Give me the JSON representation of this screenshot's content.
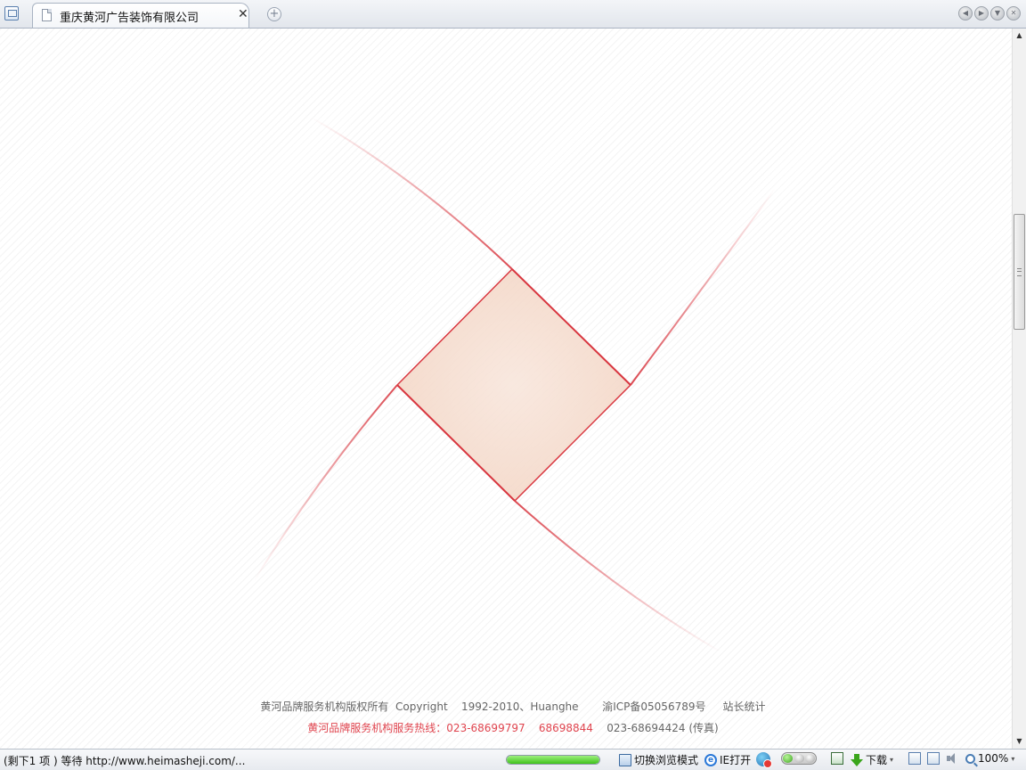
{
  "tab": {
    "title": "重庆黄河广告装饰有限公司",
    "close_glyph": "✕",
    "new_tab_glyph": "+"
  },
  "window_buttons": [
    "back-icon",
    "forward-icon",
    "menu-icon",
    "close-icon"
  ],
  "window_button_glyphs": [
    "◀",
    "▶",
    "▼",
    "✕"
  ],
  "colors": {
    "logo_red": "#d8363f",
    "logo_fill": "#f7dccd",
    "hotline_red": "#e0454f",
    "progress_green": "#3fc21a"
  },
  "footer": {
    "line1": "黄河品牌服务机构版权所有  Copyright    1992-2010、Huanghe       渝ICP备05056789号     站长统计",
    "hotline": "黄河品牌服务机构服务热线：023-68699797    68698844",
    "fax": "    023-68694424 (传真)"
  },
  "scrollbar": {
    "up_glyph": "▲",
    "down_glyph": "▼"
  },
  "status": {
    "text": "(剩下1 项 ) 等待 http://www.heimasheji.com/...",
    "progress_fraction": 1.0,
    "switch_mode_label": "切换浏览模式",
    "ie_open_label": "IE打开",
    "ie_glyph": "e",
    "download_label": "下载",
    "caret_glyph": "▾",
    "zoom_label": "100%"
  }
}
